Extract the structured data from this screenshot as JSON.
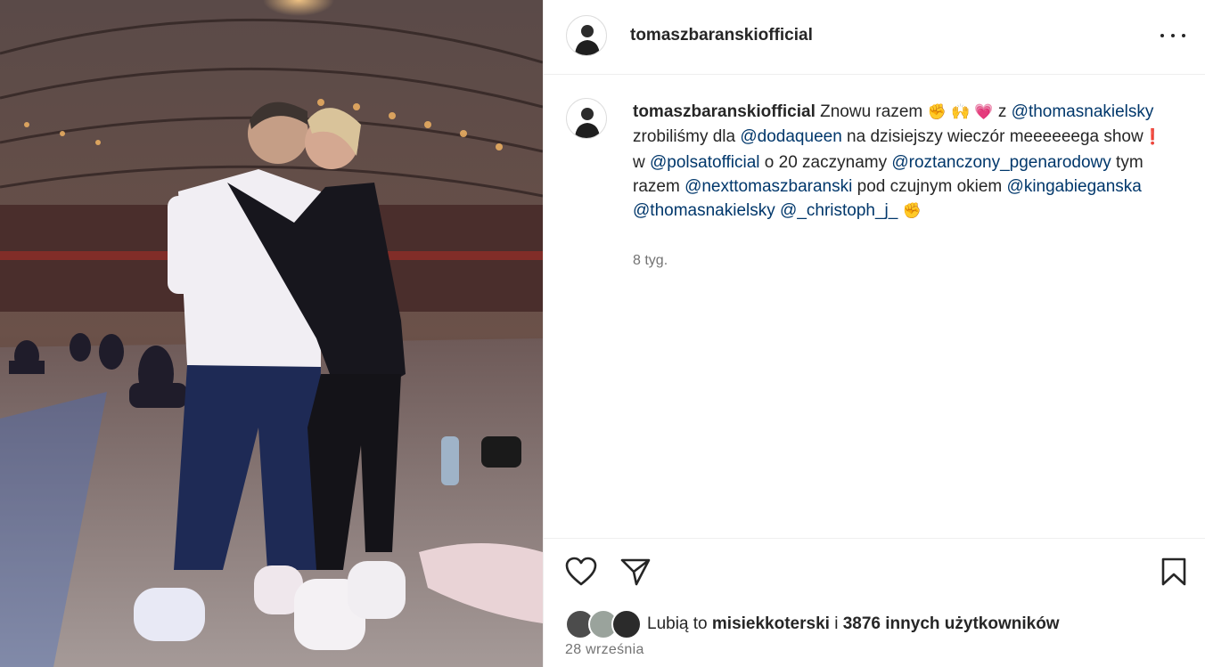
{
  "post": {
    "username": "tomaszbaranskiofficial",
    "photo_description_icon": "photo",
    "caption": {
      "username": "tomaszbaranskiofficial",
      "t1": "Znowu razem",
      "e1": "✊",
      "e2": "🙌",
      "e3": "💗",
      "t2": "z",
      "m1": "@thomasnakielsky",
      "t3": "zrobiliśmy dla",
      "m2": "@dodaqueen",
      "t4": "na dzisiejszy wieczór meeeeeega show",
      "e4": "❗",
      "t5": "w",
      "m3": "@polsatofficial",
      "t6": "o 20 zaczynamy",
      "m4": "@roztanczony_pgenarodowy",
      "t7": "tym razem",
      "m5": "@nexttomaszbaranski",
      "t8": "pod czujnym okiem",
      "m6": "@kingabieganska",
      "m7": "@thomasnakielsky",
      "m8": "@_christoph_j_",
      "e5": "✊"
    },
    "time_ago": "8 tyg.",
    "likes": {
      "prefix": "Lubią to",
      "user": "misiekkoterski",
      "mid": "i",
      "count": "3876 innych użytkowników"
    },
    "date": "28 września"
  },
  "colors": {
    "text": "#262626",
    "mention": "#00376b",
    "muted": "#737373",
    "border": "#efefef"
  }
}
